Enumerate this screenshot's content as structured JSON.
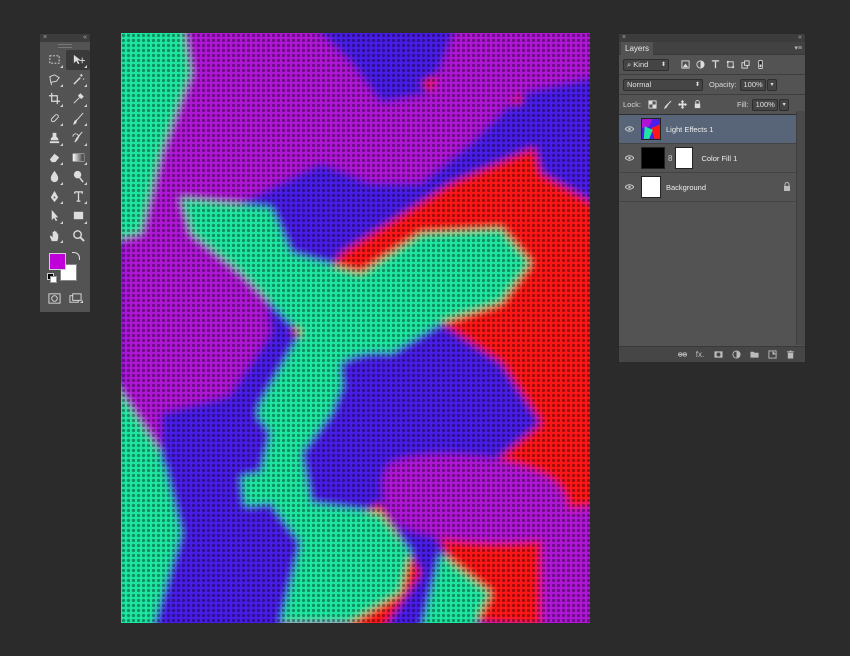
{
  "tools_panel": {
    "close_glyph": "×",
    "collapse_glyph": "«",
    "tools": [
      [
        "rect-marquee-icon",
        "move-icon"
      ],
      [
        "lasso-icon",
        "magic-wand-icon"
      ],
      [
        "crop-icon",
        "eyedropper-icon"
      ],
      [
        "healing-brush-icon",
        "brush-icon"
      ],
      [
        "clone-stamp-icon",
        "history-brush-icon"
      ],
      [
        "eraser-icon",
        "gradient-icon"
      ],
      [
        "blur-icon",
        "dodge-icon"
      ],
      [
        "pen-icon",
        "type-icon"
      ],
      [
        "path-select-icon",
        "shape-icon"
      ],
      [
        "hand-icon",
        "zoom-icon"
      ]
    ],
    "foreground_color": "#c000d8",
    "background_color": "#ffffff"
  },
  "layers_panel": {
    "close_glyph": "×",
    "collapse_glyph": "«",
    "tab_label": "Layers",
    "menu_glyph": "▾≡",
    "filter_kind": "Kind",
    "blend_mode": "Normal",
    "opacity_label": "Opacity:",
    "opacity_value": "100%",
    "lock_label": "Lock:",
    "fill_label": "Fill:",
    "fill_value": "100%",
    "layers": [
      {
        "name": "Light Effects 1",
        "active": true
      },
      {
        "name": "Color Fill 1",
        "active": false
      },
      {
        "name": "Background",
        "active": false
      }
    ],
    "footer_fx": "fx."
  },
  "colors": {
    "app_bg": "#2b2b2b",
    "panel_bg": "#535353",
    "selected_layer": "#586578",
    "art_red": "#ff1616",
    "art_magenta": "#b012d6",
    "art_blue": "#4a1ee8",
    "art_green": "#1ee6a0"
  }
}
